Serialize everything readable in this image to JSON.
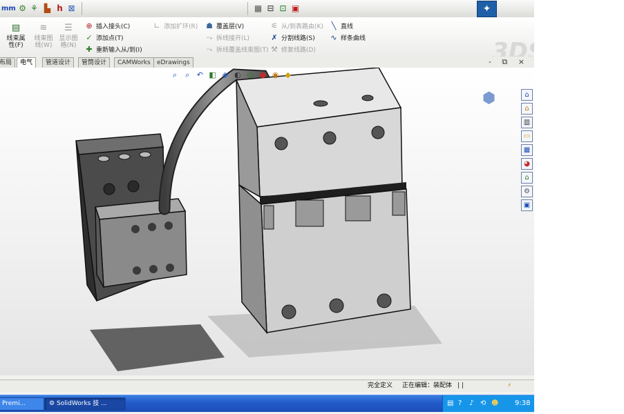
{
  "toolbar": {
    "items": [
      "mm-icon",
      "gear-icon",
      "route-icon",
      "chart-icon",
      "h-icon",
      "select-icon"
    ],
    "right_items": [
      "grid-icon",
      "view-icon",
      "measure-icon",
      "settings-icon"
    ]
  },
  "ribbon": {
    "big_buttons": [
      {
        "label": "线束属性(F)",
        "icon": "harness-icon",
        "disabled": false
      },
      {
        "label": "线束图线(W)",
        "icon": "wire-icon",
        "disabled": true
      },
      {
        "label": "显示图格(N)",
        "icon": "table-icon",
        "disabled": true
      }
    ],
    "col1": [
      "插入接头(C)",
      "添加点(T)",
      "重新输入从/到(I)"
    ],
    "col2": [
      "添加扩环(R)"
    ],
    "col3": [
      "覆盖层(V)",
      "拆线接开(L)",
      "拆线覆盖线束图(T)"
    ],
    "col4": [
      "从/到表路由(K)",
      "分割线路(S)",
      "修复线路(D)"
    ],
    "col5": [
      "直线",
      "样条曲线"
    ]
  },
  "tabs": [
    "布局",
    "电气",
    "管道设计",
    "管筒设计",
    "CAMWorks",
    "eDrawings"
  ],
  "active_tab": "电气",
  "window_controls": "- ⧉ ×",
  "viewport": {
    "heads_up_icons": [
      "zoom-fit-icon",
      "zoom-area-icon",
      "previous-view-icon",
      "section-view-icon",
      "view-orientation-icon",
      "display-style-icon",
      "hide-show-icon",
      "edit-appearance-icon",
      "scene-icon",
      "display-settings-icon"
    ],
    "taskpane_icons": [
      "resources-icon",
      "home-icon",
      "design-library-icon",
      "file-explorer-icon",
      "view-palette-icon",
      "appearances-icon",
      "custom-properties-icon",
      "toolbox-icon",
      "3d-content-icon"
    ]
  },
  "status": {
    "definition": "完全定义",
    "editing": "正在编辑：装配体",
    "bars": "| |"
  },
  "taskbar": {
    "prev_window": "Premi...",
    "active_window": "SolidWorks 技 ...",
    "clock": "9:38"
  },
  "colors": {
    "taskbar_blue": "#225ac9",
    "tray_blue": "#1796e9",
    "breaker_light": "#d8d8d8",
    "contactor_dark": "#4b4b4b"
  }
}
